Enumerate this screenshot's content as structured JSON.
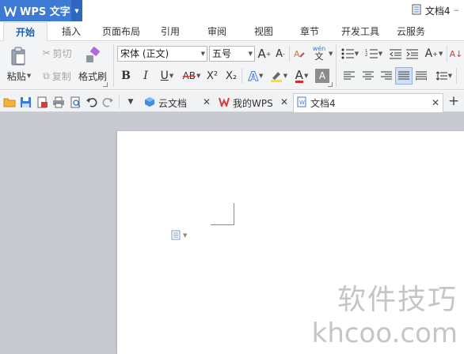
{
  "app": {
    "name": "WPS 文字",
    "document_title": "文档4"
  },
  "ribbon_tabs": [
    "开始",
    "插入",
    "页面布局",
    "引用",
    "审阅",
    "视图",
    "章节",
    "开发工具",
    "云服务"
  ],
  "clipboard": {
    "paste": "粘贴",
    "cut": "剪切",
    "copy": "复制",
    "format_painter": "格式刷"
  },
  "font": {
    "name": "宋体 (正文)",
    "size": "五号"
  },
  "format_buttons": {
    "bold": "B",
    "italic": "I",
    "underline": "U",
    "strike": "AB",
    "superscript": "X²",
    "subscript": "X₂",
    "size_up": "A",
    "size_down": "A",
    "font_color": "A",
    "char_shade": "A",
    "text_effect": "A",
    "phonetic_top": "wén",
    "phonetic_bottom": "文"
  },
  "doc_tabs": [
    {
      "label": "云文档"
    },
    {
      "label": "我的WPS"
    },
    {
      "label": "文档4"
    }
  ],
  "watermark": {
    "line1": "软件技巧",
    "line2": "khcoo.com"
  },
  "colors": {
    "accent": "#3d7ad6",
    "workspace": "#c7cbd1",
    "page": "#ffffff"
  }
}
